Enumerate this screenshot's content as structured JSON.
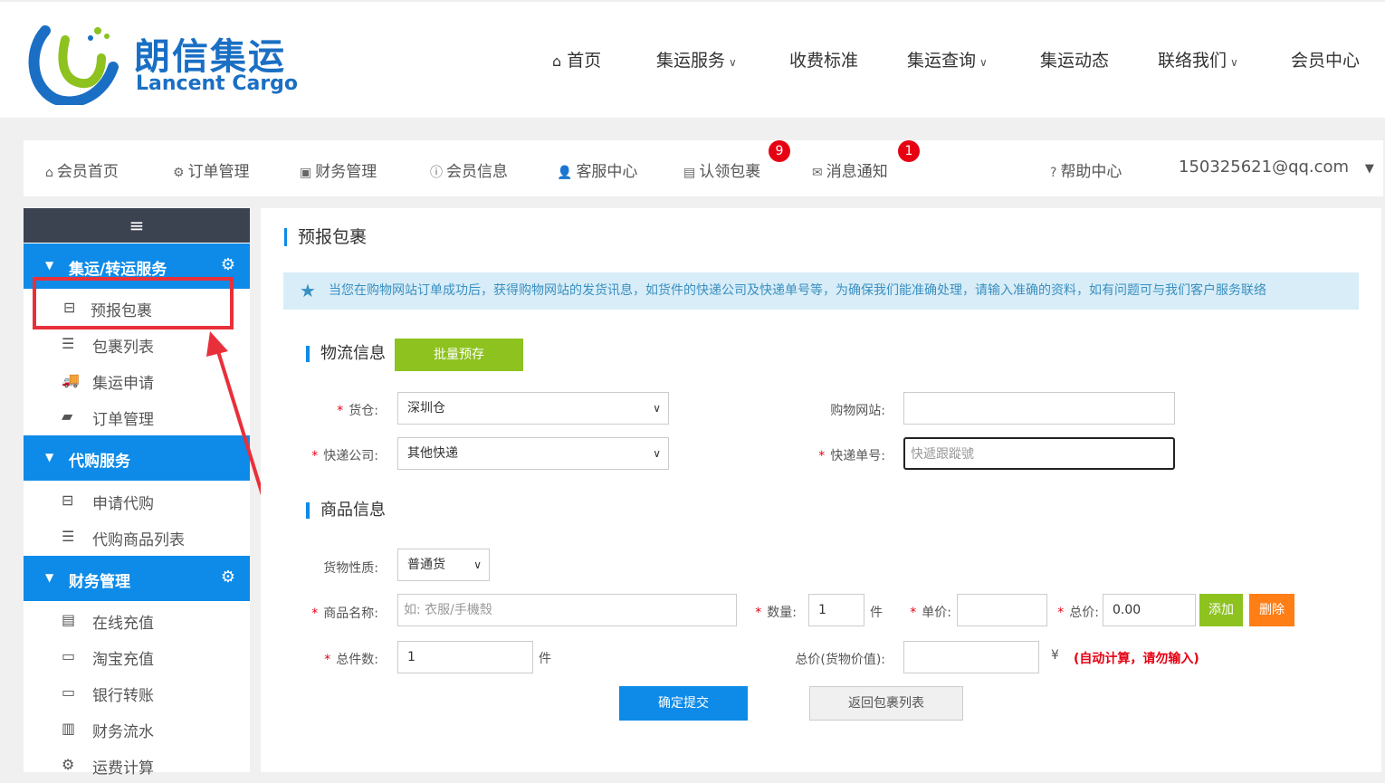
{
  "header": {
    "logo_cn": "朗信集运",
    "logo_en": "Lancent Cargo",
    "nav": [
      {
        "label": "首页",
        "icon": "home-icon",
        "dropdown": false
      },
      {
        "label": "集运服务",
        "dropdown": true
      },
      {
        "label": "收费标准",
        "dropdown": false
      },
      {
        "label": "集运查询",
        "dropdown": true
      },
      {
        "label": "集运动态",
        "dropdown": false
      },
      {
        "label": "联络我们",
        "dropdown": true
      },
      {
        "label": "会员中心",
        "dropdown": false
      }
    ]
  },
  "member_bar": {
    "items": [
      {
        "label": "会员首页",
        "icon": "home-icon"
      },
      {
        "label": "订单管理",
        "icon": "gear-icon"
      },
      {
        "label": "财务管理",
        "icon": "money-icon"
      },
      {
        "label": "会员信息",
        "icon": "info-icon"
      },
      {
        "label": "客服中心",
        "icon": "user-icon"
      },
      {
        "label": "认领包裹",
        "icon": "archive-icon",
        "badge": "9"
      },
      {
        "label": "消息通知",
        "icon": "envelope-icon",
        "badge": "1"
      }
    ],
    "help": "帮助中心",
    "account": "150325621@qq.com"
  },
  "sidebar": {
    "sections": [
      {
        "title": "集运/转运服务",
        "items": [
          "预报包裹",
          "包裹列表",
          "集运申请",
          "订单管理"
        ]
      },
      {
        "title": "代购服务",
        "items": [
          "申请代购",
          "代购商品列表"
        ]
      },
      {
        "title": "财务管理",
        "items": [
          "在线充值",
          "淘宝充值",
          "银行转账",
          "财务流水",
          "运费计算"
        ]
      }
    ]
  },
  "content": {
    "title": "预报包裹",
    "notice": "当您在购物网站订单成功后，获得购物网站的发货讯息，如货件的快递公司及快递单号等，为确保我们能准确处理，请输入准确的资料，如有问题可与我们客户服务联络",
    "logistics": {
      "title": "物流信息",
      "batch_button": "批量预存",
      "warehouse_label": "货仓:",
      "warehouse_value": "深圳仓",
      "site_label": "购物网站:",
      "site_value": "",
      "courier_label": "快递公司:",
      "courier_value": "其他快递",
      "tracking_label": "快递单号:",
      "tracking_placeholder": "快遞跟蹤號"
    },
    "goods": {
      "title": "商品信息",
      "nature_label": "货物性质:",
      "nature_value": "普通货",
      "name_label": "商品名称:",
      "name_placeholder": "如: 衣服/手機殼",
      "qty_label": "数量:",
      "qty_value": "1",
      "qty_unit": "件",
      "price_label": "单价:",
      "price_value": "",
      "total_label": "总价:",
      "total_value": "0.00",
      "add_button": "添加",
      "delete_button": "删除",
      "count_label": "总件数:",
      "count_value": "1",
      "count_unit": "件",
      "value_label": "总价(货物价值):",
      "value_value": "",
      "currency": "¥",
      "auto_note": "(自动计算，请勿输入)"
    },
    "submit_button": "确定提交",
    "back_button": "返回包裹列表"
  },
  "colors": {
    "brand_blue": "#0e8be8",
    "green": "#8dc21f",
    "orange": "#ff7e16",
    "red": "#e60012",
    "annotation_red": "#e8303a"
  }
}
